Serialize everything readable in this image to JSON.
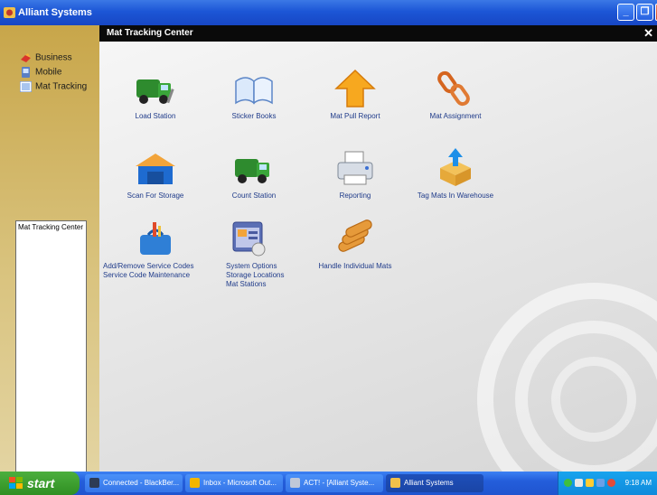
{
  "window": {
    "title": "Alliant Systems"
  },
  "sidebar": {
    "items": [
      {
        "label": "Business",
        "icon": "business-icon"
      },
      {
        "label": "Mobile",
        "icon": "mobile-icon"
      },
      {
        "label": "Mat Tracking",
        "icon": "mat-tracking-icon"
      }
    ],
    "list_items": [
      "Mat Tracking Center"
    ]
  },
  "main": {
    "header": "Mat Tracking Center",
    "tiles": [
      {
        "label": "Load Station",
        "icon": "truck-icon"
      },
      {
        "label": "Sticker Books",
        "icon": "book-icon"
      },
      {
        "label": "Mat Pull Report",
        "icon": "up-arrow-icon"
      },
      {
        "label": "Mat Assignment",
        "icon": "chain-link-icon"
      },
      {
        "label": "Scan For Storage",
        "icon": "warehouse-icon"
      },
      {
        "label": "Count Station",
        "icon": "truck-icon"
      },
      {
        "label": "Reporting",
        "icon": "printer-icon"
      },
      {
        "label": "Tag Mats In Warehouse",
        "icon": "box-arrow-icon"
      },
      {
        "label": "Add/Remove Service Codes",
        "label2": "Service Code Maintenance",
        "icon": "toolbox-icon"
      },
      {
        "label": "System Options",
        "label2": "Storage Locations",
        "label3": "Mat Stations",
        "icon": "settings-window-icon"
      },
      {
        "label": "Handle Individual Mats",
        "icon": "rolled-mats-icon"
      }
    ]
  },
  "taskbar": {
    "start": "start",
    "tasks": [
      {
        "label": "Connected - BlackBer..."
      },
      {
        "label": "Inbox - Microsoft Out..."
      },
      {
        "label": "ACT! - [Alliant Syste..."
      },
      {
        "label": "Alliant Systems"
      }
    ],
    "time": "9:18 AM"
  },
  "colors": {
    "titlebar": "#1c56d6",
    "sidebar": "#c8a64a",
    "link": "#1f3b8a"
  }
}
